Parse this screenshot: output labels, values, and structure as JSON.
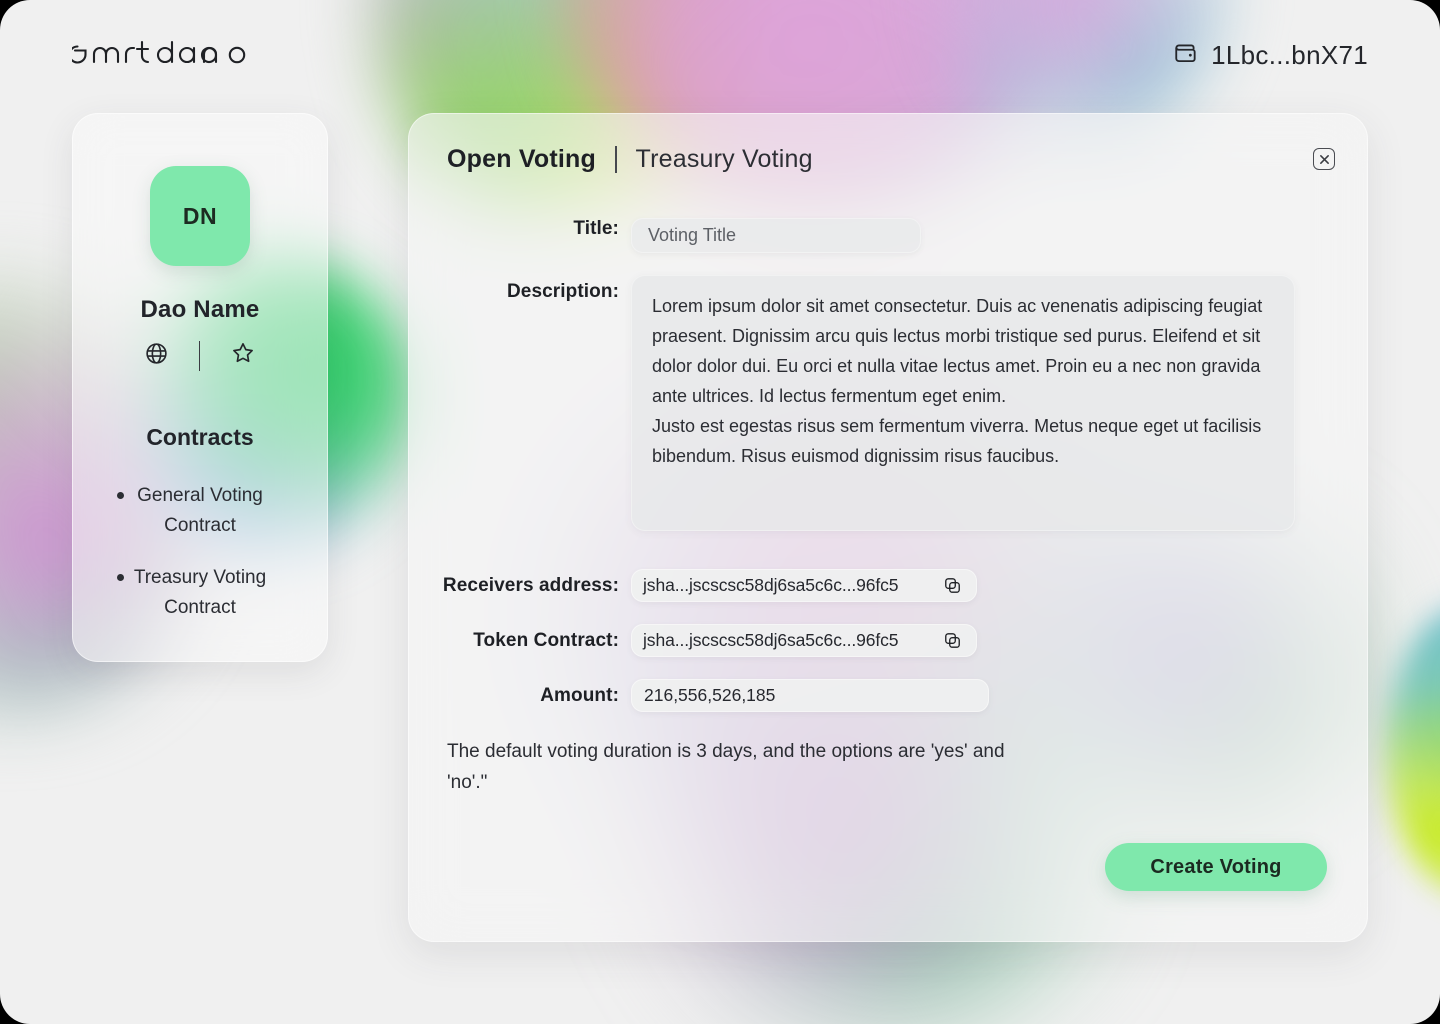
{
  "brand": {
    "logo_text": "smartdao"
  },
  "header": {
    "wallet_icon": "wallet-icon",
    "wallet_address": "1Lbc...bnX71"
  },
  "sidebar": {
    "avatar_initials": "DN",
    "dao_name": "Dao Name",
    "social_icons": [
      "globe-icon",
      "star-icon"
    ],
    "contracts_title": "Contracts",
    "contracts": [
      "General Voting Contract",
      "Treasury Voting Contract"
    ]
  },
  "modal": {
    "title": "Open Voting",
    "subtitle": "Treasury Voting",
    "close_icon": "close-icon",
    "fields": {
      "title_label": "Title:",
      "title_placeholder": "Voting Title",
      "description_label": "Description:",
      "description_paragraph_1": "Lorem ipsum dolor sit amet consectetur. Duis ac venenatis adipiscing feugiat praesent. Dignissim arcu quis lectus morbi tristique sed purus. Eleifend et sit dolor dolor dui. Eu orci et nulla vitae lectus amet. Proin eu a nec non gravida ante ultrices. Id lectus fermentum eget enim.",
      "description_paragraph_2": "Justo est egestas risus sem fermentum viverra. Metus neque eget ut facilisis bibendum. Risus euismod dignissim risus faucibus.",
      "receivers_label": "Receivers address:",
      "receivers_value": "jsha...jscscsc58dj6sa5c6c...96fc5",
      "token_label": "Token Contract:",
      "token_value": "jsha...jscscsc58dj6sa5c6c...96fc5",
      "amount_label": "Amount:",
      "amount_value": "216,556,526,185"
    },
    "note": "The default voting duration is 3 days, and the options are 'yes' and 'no'.\"",
    "submit_label": "Create Voting"
  },
  "colors": {
    "accent_green": "#7fe8ac",
    "page_background": "#f0f0f0",
    "text_dark": "#1e2025"
  }
}
